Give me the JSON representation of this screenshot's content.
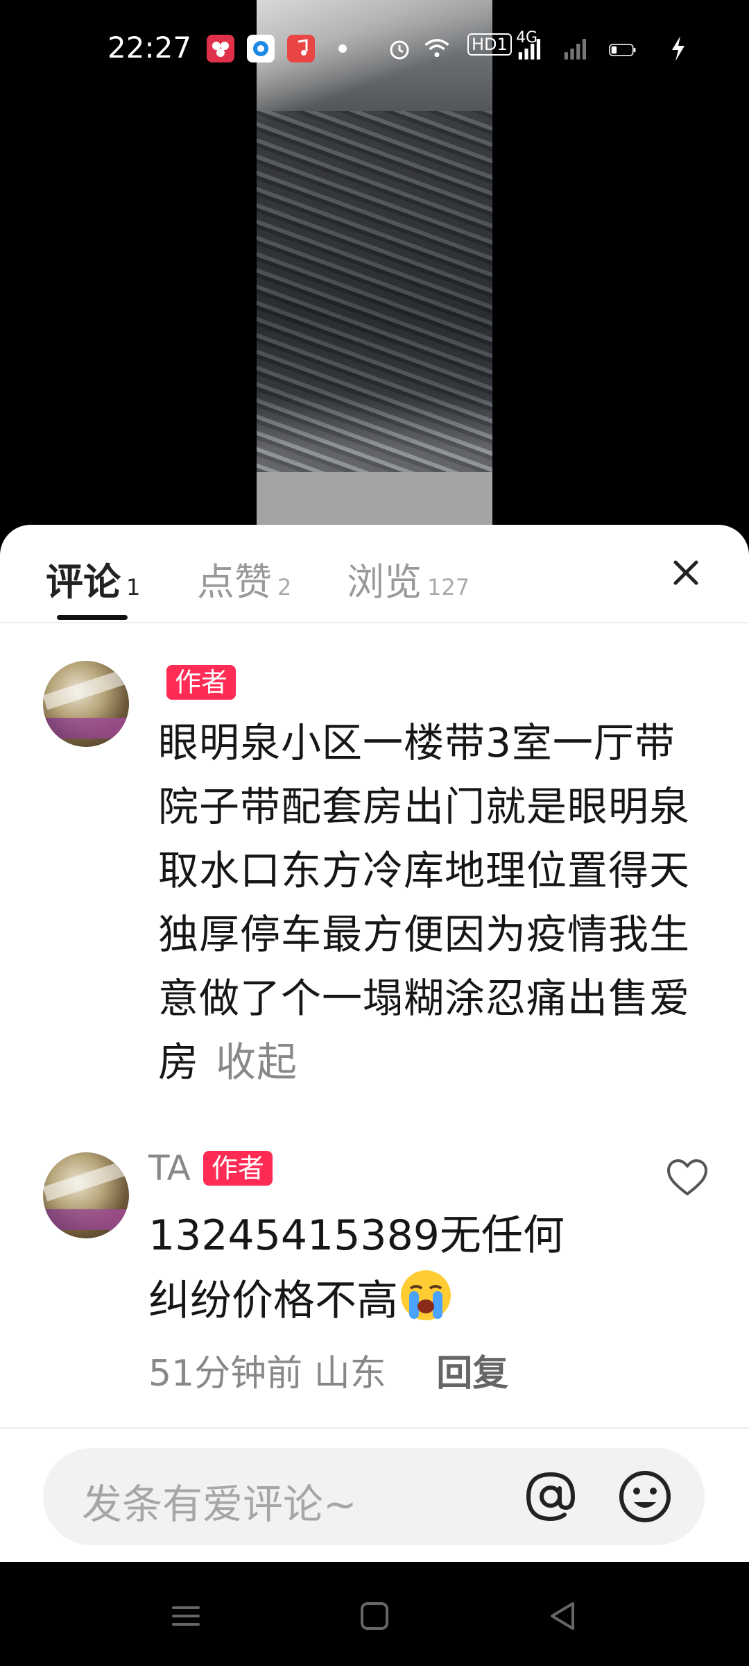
{
  "status_bar": {
    "time": "22:27",
    "network_label": "4G",
    "hd_label": "HD1",
    "icons": [
      "app-icon-red",
      "app-icon-blue",
      "app-icon-music",
      "alarm-icon",
      "wifi-icon",
      "signal-icon",
      "battery-icon",
      "charging-icon"
    ]
  },
  "tabs": [
    {
      "label": "评论",
      "count": "1",
      "active": true
    },
    {
      "label": "点赞",
      "count": "2",
      "active": false
    },
    {
      "label": "浏览",
      "count": "127",
      "active": false
    }
  ],
  "comments": [
    {
      "badge": "作者",
      "text": "眼明泉小区一楼带3室一厅带院子带配套房出门就是眼明泉取水口东方冷库地理位置得天独厚停车最方便因为疫情我生意做了个一塌糊涂忍痛出售爱房",
      "collapse_label": "收起"
    },
    {
      "name": "TA",
      "badge": "作者",
      "text": "13245415389无任何纠纷价格不高",
      "emoji": "crying-emoji",
      "time": "51分钟前",
      "location": "山东",
      "reply_label": "回复"
    }
  ],
  "input": {
    "placeholder": "发条有爱评论~"
  },
  "colors": {
    "accent": "#fe2c55",
    "text": "#161616",
    "muted": "#888888"
  }
}
